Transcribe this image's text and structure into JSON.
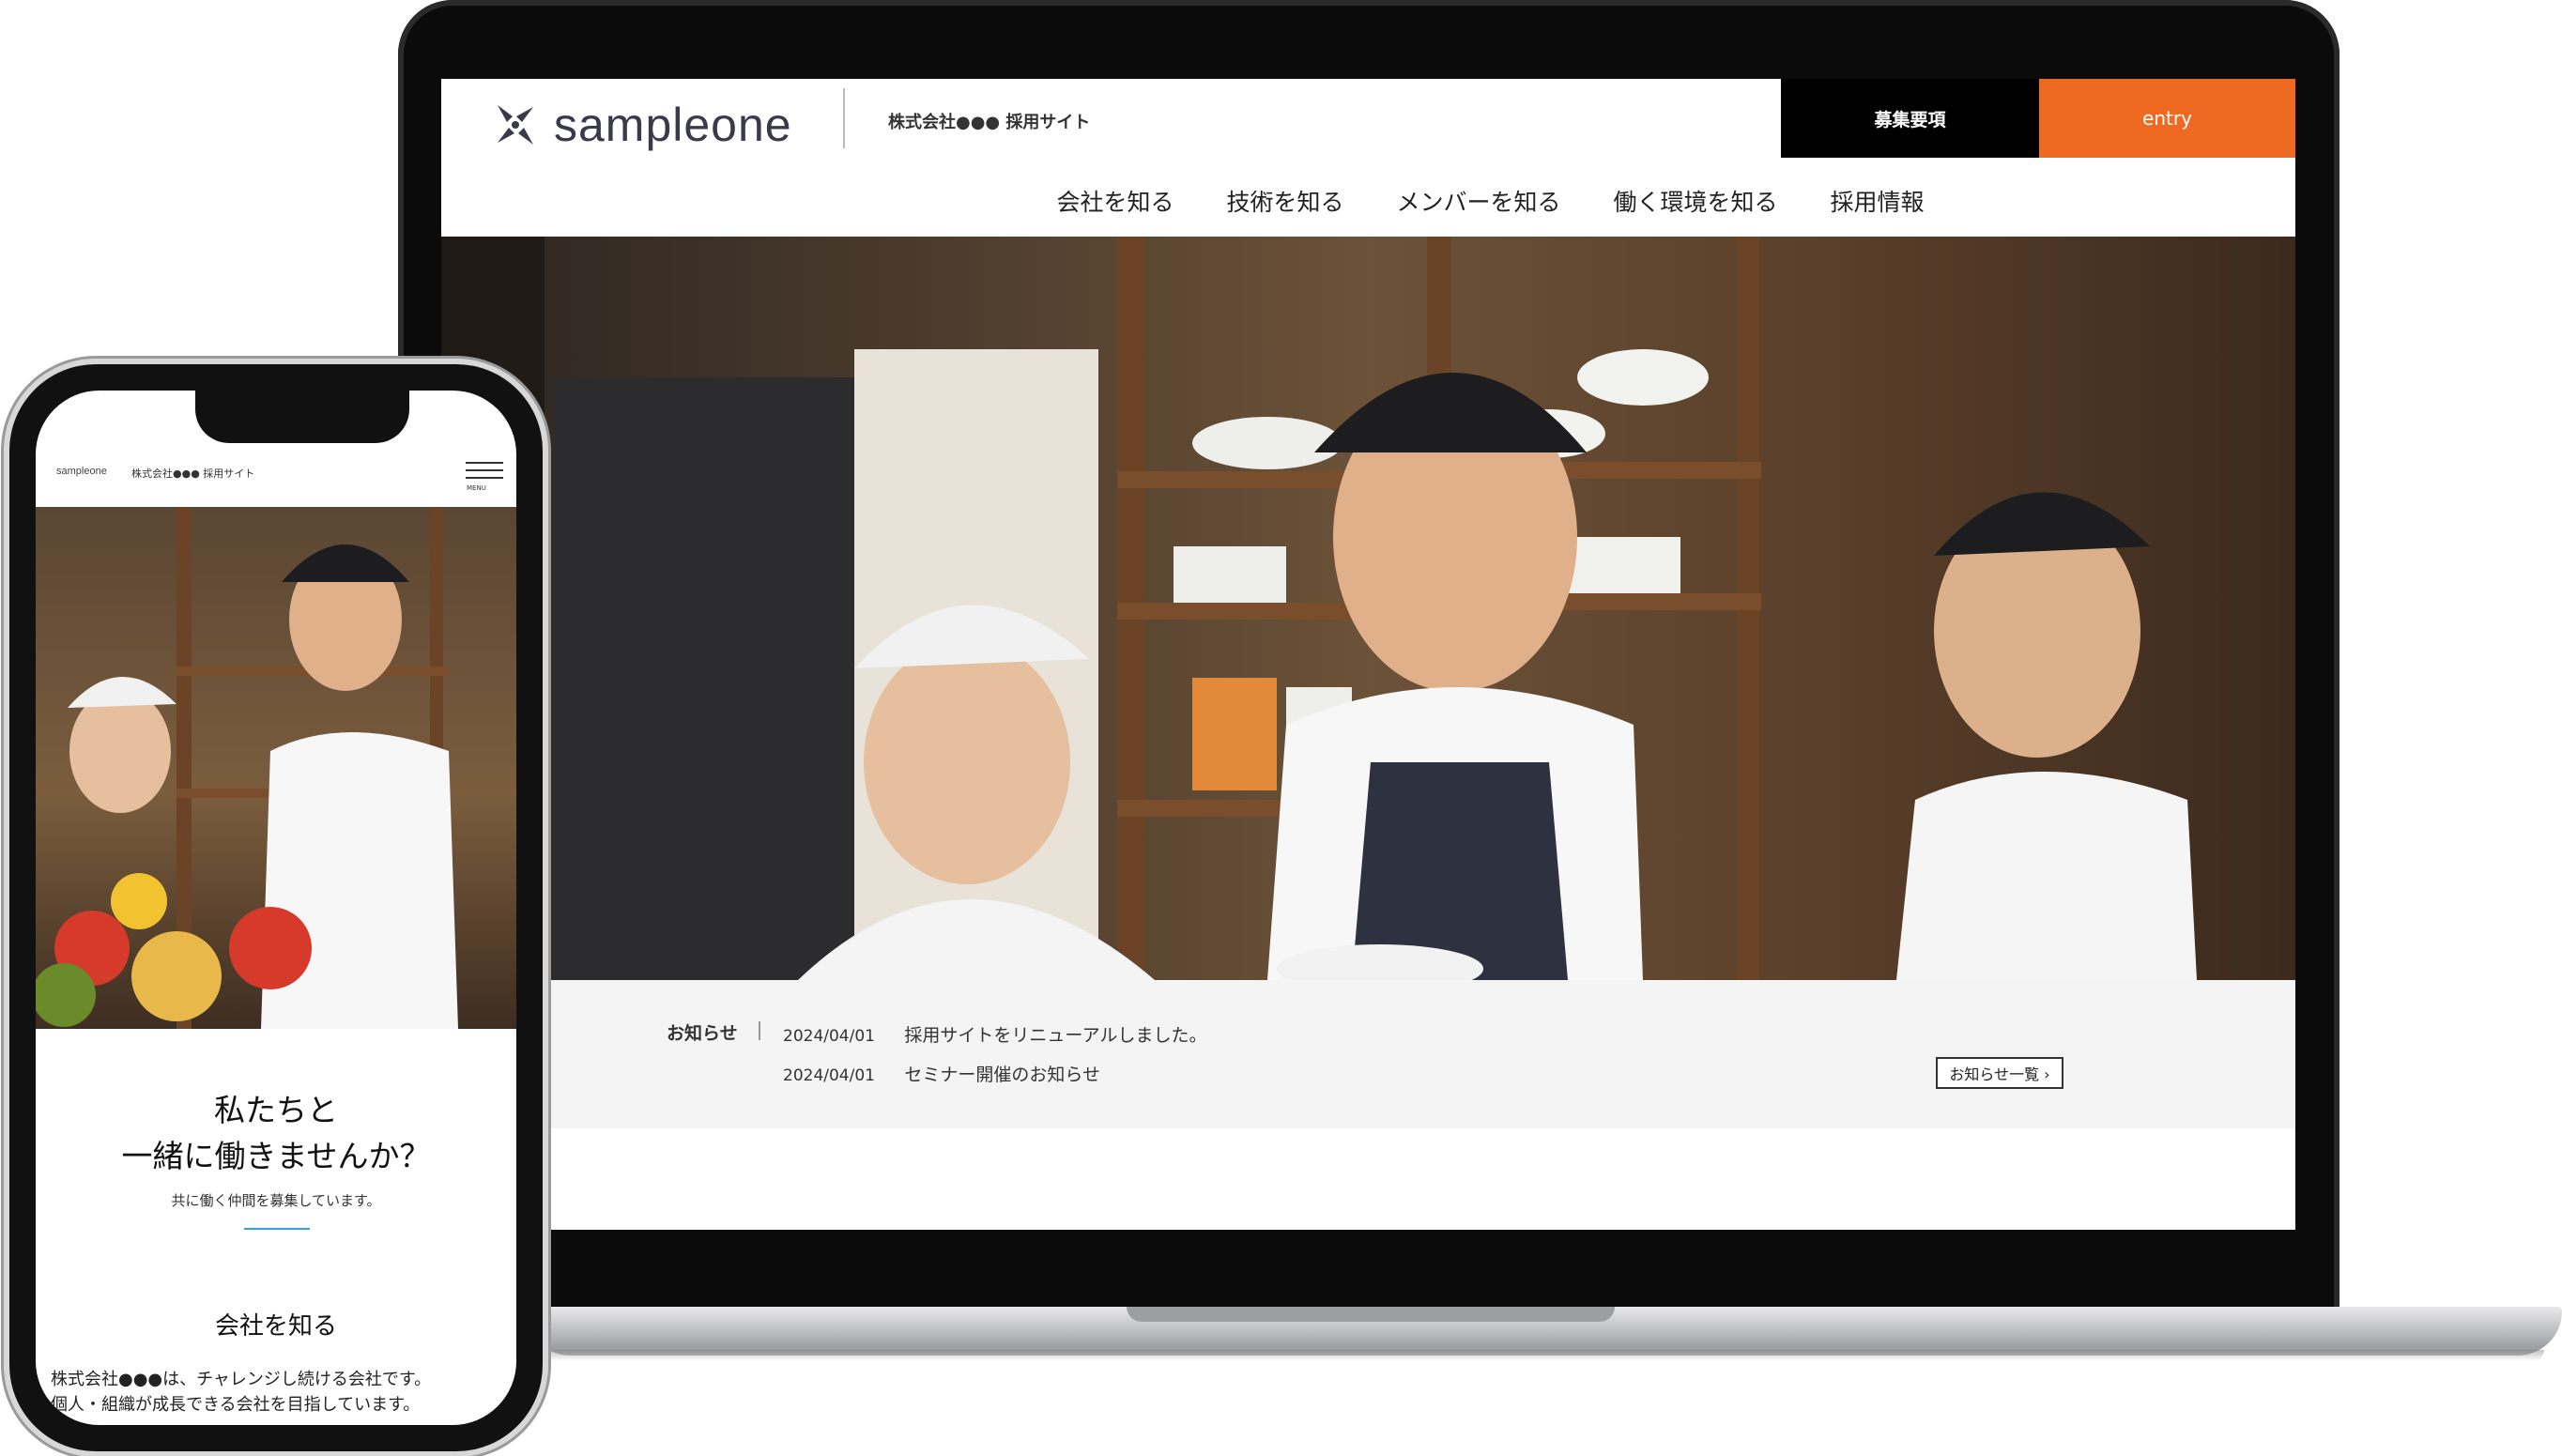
{
  "laptop": {
    "header": {
      "logo_text": "sampleone",
      "site_name": "株式会社●●● 採用サイト",
      "recruit_button": "募集要項",
      "entry_button": "entry"
    },
    "nav": {
      "items": [
        {
          "label": "会社を知る"
        },
        {
          "label": "技術を知る"
        },
        {
          "label": "メンバーを知る"
        },
        {
          "label": "働く環境を知る"
        },
        {
          "label": "採用情報"
        }
      ]
    },
    "hero": {
      "icon": "hero-photo-staff-kitchen"
    },
    "news": {
      "label": "お知らせ",
      "items": [
        {
          "date": "2024/04/01",
          "title": "採用サイトをリニューアルしました。"
        },
        {
          "date": "2024/04/01",
          "title": "セミナー開催のお知らせ"
        }
      ],
      "more_button": "お知らせ一覧 ›"
    }
  },
  "phone": {
    "header": {
      "logo_text": "sampleone",
      "site_name": "株式会社●●● 採用サイト",
      "menu_label": "MENU"
    },
    "heading_line1": "私たちと",
    "heading_line2": "一緒に働きませんか？",
    "subheading": "共に働く仲間を募集しています。",
    "section_title": "会社を知る",
    "body_text": "株式会社●●●は、チャレンジし続ける会社です。\n個人・組織が成長できる会社を目指しています。"
  },
  "colors": {
    "entry_accent": "#ee6a22",
    "recruit_button": "#000000",
    "rule_accent": "#35a3d6",
    "news_bg": "#f4f4f4"
  }
}
